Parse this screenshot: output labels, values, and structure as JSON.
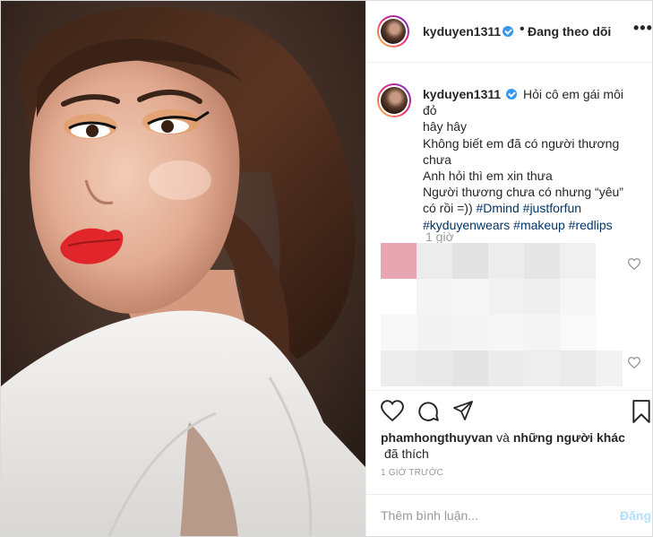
{
  "header": {
    "username": "kyduyen1311",
    "separator": "•",
    "follow_label": "Đang theo dõi",
    "more_label": "•••"
  },
  "caption": {
    "username": "kyduyen1311",
    "lines": [
      "Hỏi cô em gái môi đỏ",
      "hây hây",
      "Không biết em đã có người thương",
      "chưa",
      "Anh hỏi thì em xin thưa",
      "Người thương chưa có nhưng “yêu”",
      "có rồi =))"
    ],
    "hashtags_line1": [
      "#Dmind",
      "#justforfun"
    ],
    "hashtags_line2": [
      "#kyduyenwears",
      "#makeup",
      "#redlips"
    ],
    "time": "1 giờ"
  },
  "likes": {
    "user": "phamhongthuyvan",
    "connector": "và",
    "others": "những người khác",
    "liked_label": "đã thích"
  },
  "post_time": "1 GIỜ TRƯỚC",
  "comment": {
    "placeholder": "Thêm bình luận...",
    "post_label": "Đăng"
  },
  "icons": {
    "like": "heart-icon",
    "comment": "comment-icon",
    "share": "share-icon",
    "save": "bookmark-icon"
  },
  "colors": {
    "link": "#003569",
    "verified": "#3897f0",
    "muted": "#999999",
    "post_button": "#b2dffc"
  }
}
